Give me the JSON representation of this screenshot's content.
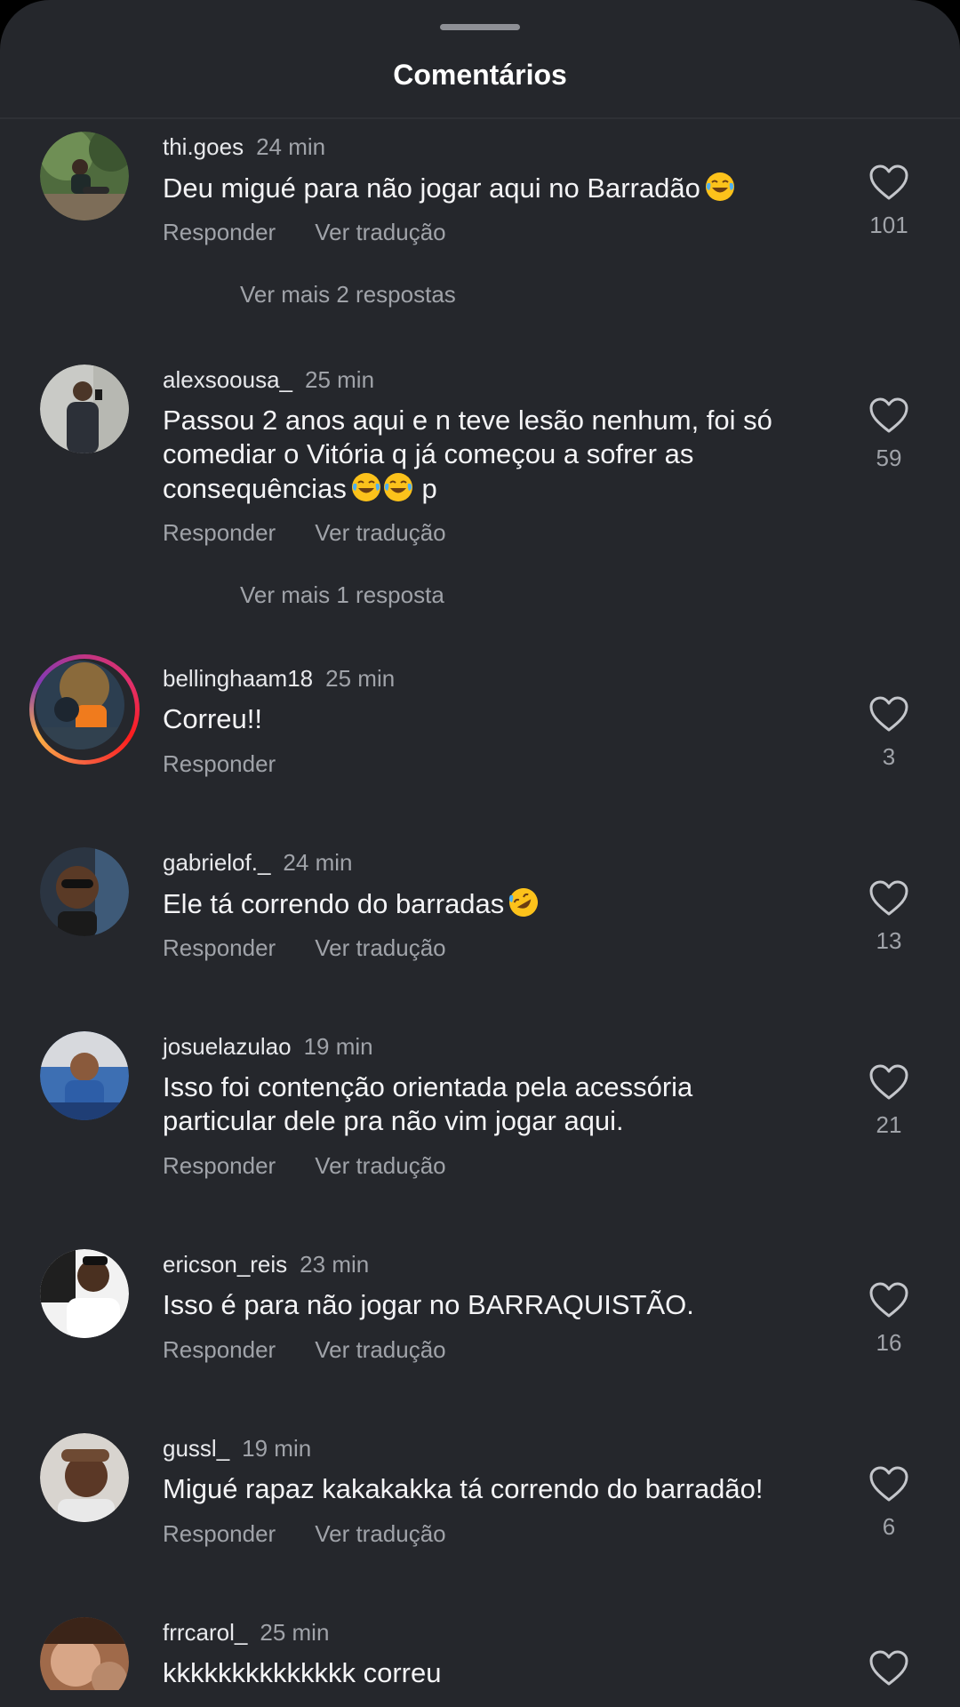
{
  "header": {
    "title": "Comentários"
  },
  "colors": {
    "background": "#25272c",
    "text_primary": "#f4f4f6",
    "text_secondary": "#a0a3a9"
  },
  "comments": [
    {
      "username": "thi.goes",
      "time": "24 min",
      "text": "Deu migué para não jogar aqui no Barradão",
      "emoji": [
        "laughing-tears-emoji"
      ],
      "reply_label": "Responder",
      "translate_label": "Ver tradução",
      "likes": "101",
      "more_replies": "Ver mais 2 respostas"
    },
    {
      "username": "alexsoousa_",
      "time": "25 min",
      "text": "Passou 2 anos aqui e n teve lesão nenhum, foi só comediar o Vitória q já começou a sofrer as consequências",
      "text_suffix": "p",
      "emoji": [
        "laughing-tears-emoji",
        "laughing-tears-emoji"
      ],
      "reply_label": "Responder",
      "translate_label": "Ver tradução",
      "likes": "59",
      "more_replies": "Ver mais 1 resposta"
    },
    {
      "username": "bellinghaam18",
      "time": "25 min",
      "text": "Correu!!",
      "reply_label": "Responder",
      "likes": "3"
    },
    {
      "username": "gabrielof._",
      "time": "24 min",
      "text": "Ele tá correndo do barradas",
      "emoji": [
        "rolling-laughing-emoji"
      ],
      "reply_label": "Responder",
      "translate_label": "Ver tradução",
      "likes": "13"
    },
    {
      "username": "josuelazulao",
      "time": "19 min",
      "text": "Isso foi contenção orientada pela acessória particular dele pra não vim jogar aqui.",
      "reply_label": "Responder",
      "translate_label": "Ver tradução",
      "likes": "21"
    },
    {
      "username": "ericson_reis",
      "time": "23 min",
      "text": "Isso é para não jogar no BARRAQUISTÃO.",
      "reply_label": "Responder",
      "translate_label": "Ver tradução",
      "likes": "16"
    },
    {
      "username": "gussl_",
      "time": "19 min",
      "text": "Migué rapaz kakakakka tá correndo do barradão!",
      "reply_label": "Responder",
      "translate_label": "Ver tradução",
      "likes": "6"
    },
    {
      "username": "frrcarol_",
      "time": "25 min",
      "text": "kkkkkkkkkkkkkk correu"
    }
  ]
}
